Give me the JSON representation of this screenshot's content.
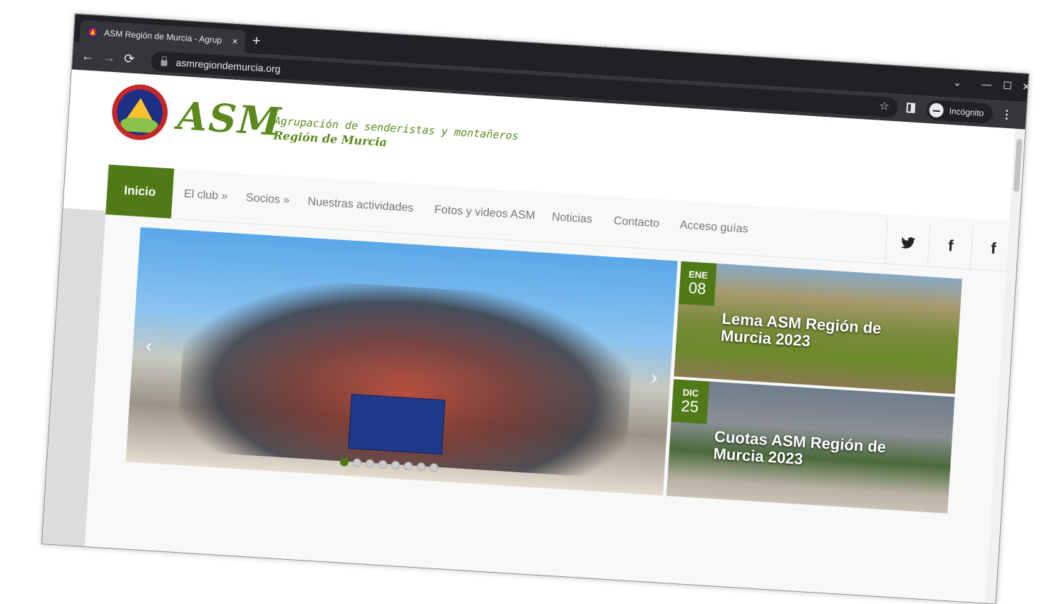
{
  "browser": {
    "tab_title": "ASM Región de Murcia - Agrupac",
    "tab_close": "×",
    "new_tab": "+",
    "url": "asmregiondemurcia.org",
    "incognito_label": "Incógnito",
    "window_controls": {
      "minimize": "—",
      "maximize": "☐",
      "close": "✕",
      "tab_search": "⌄"
    },
    "nav": {
      "back": "←",
      "forward": "→",
      "reload": "⟳"
    },
    "star": "☆",
    "menu": "⋮"
  },
  "site": {
    "logo_text": "ASM",
    "tagline_1": "Agrupación de senderistas y montañeros",
    "tagline_2": "Región de Murcia",
    "brand_color": "#4f7a17"
  },
  "menu": {
    "home": "Inicio",
    "items": [
      "El club »",
      "Socios »",
      "Nuestras actividades",
      "Fotos y videos ASM",
      "Noticias",
      "Contacto",
      "Acceso guías"
    ],
    "social": [
      "twitter-icon",
      "facebook-icon",
      "facebook-photos-icon"
    ]
  },
  "slider": {
    "prev": "‹",
    "next": "›",
    "dot_count": 8,
    "active_dot": 1
  },
  "cards": [
    {
      "month": "ENE",
      "day": "08",
      "title": "Lema ASM Región de Murcia 2023"
    },
    {
      "month": "DIC",
      "day": "25",
      "title": "Cuotas ASM Región de Murcia 2023"
    }
  ],
  "social_glyphs": {
    "twitter": "🐦",
    "facebook": "f",
    "facebook_photos": "f"
  }
}
